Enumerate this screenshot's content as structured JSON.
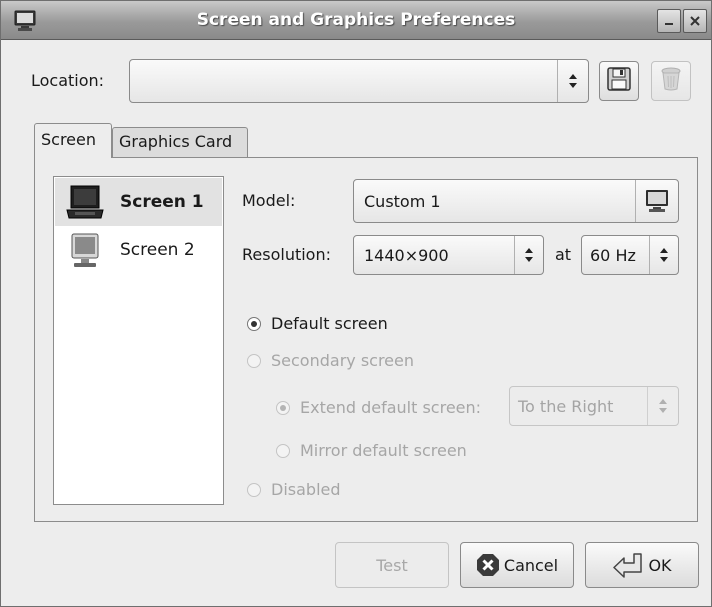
{
  "window": {
    "title": "Screen and Graphics Preferences",
    "icons": {
      "app": "monitor-icon",
      "minimize": "minimize-icon",
      "close": "close-icon"
    }
  },
  "location": {
    "label": "Location:",
    "value": "",
    "save_icon": "floppy-disk-icon",
    "delete_icon": "trash-icon"
  },
  "tabs": [
    {
      "label": "Screen",
      "active": true
    },
    {
      "label": "Graphics Card",
      "active": false
    }
  ],
  "screens": [
    {
      "label": "Screen 1",
      "selected": true,
      "icon": "laptop-icon"
    },
    {
      "label": "Screen 2",
      "selected": false,
      "icon": "monitor-icon"
    }
  ],
  "form": {
    "model_label": "Model:",
    "model_value": "Custom 1",
    "resolution_label": "Resolution:",
    "resolution_value": "1440×900",
    "at_label": "at",
    "refresh_value": "60 Hz"
  },
  "options": {
    "default_screen": "Default screen",
    "secondary_screen": "Secondary screen",
    "extend_default": "Extend default screen:",
    "extend_position": "To the Right",
    "mirror_default": "Mirror default screen",
    "disabled": "Disabled"
  },
  "buttons": {
    "test": "Test",
    "cancel": "Cancel",
    "ok": "OK"
  },
  "colors": {
    "window_bg": "#ededed",
    "titlebar": "#9a9a9a",
    "disabled_text": "#a6a6a6"
  }
}
